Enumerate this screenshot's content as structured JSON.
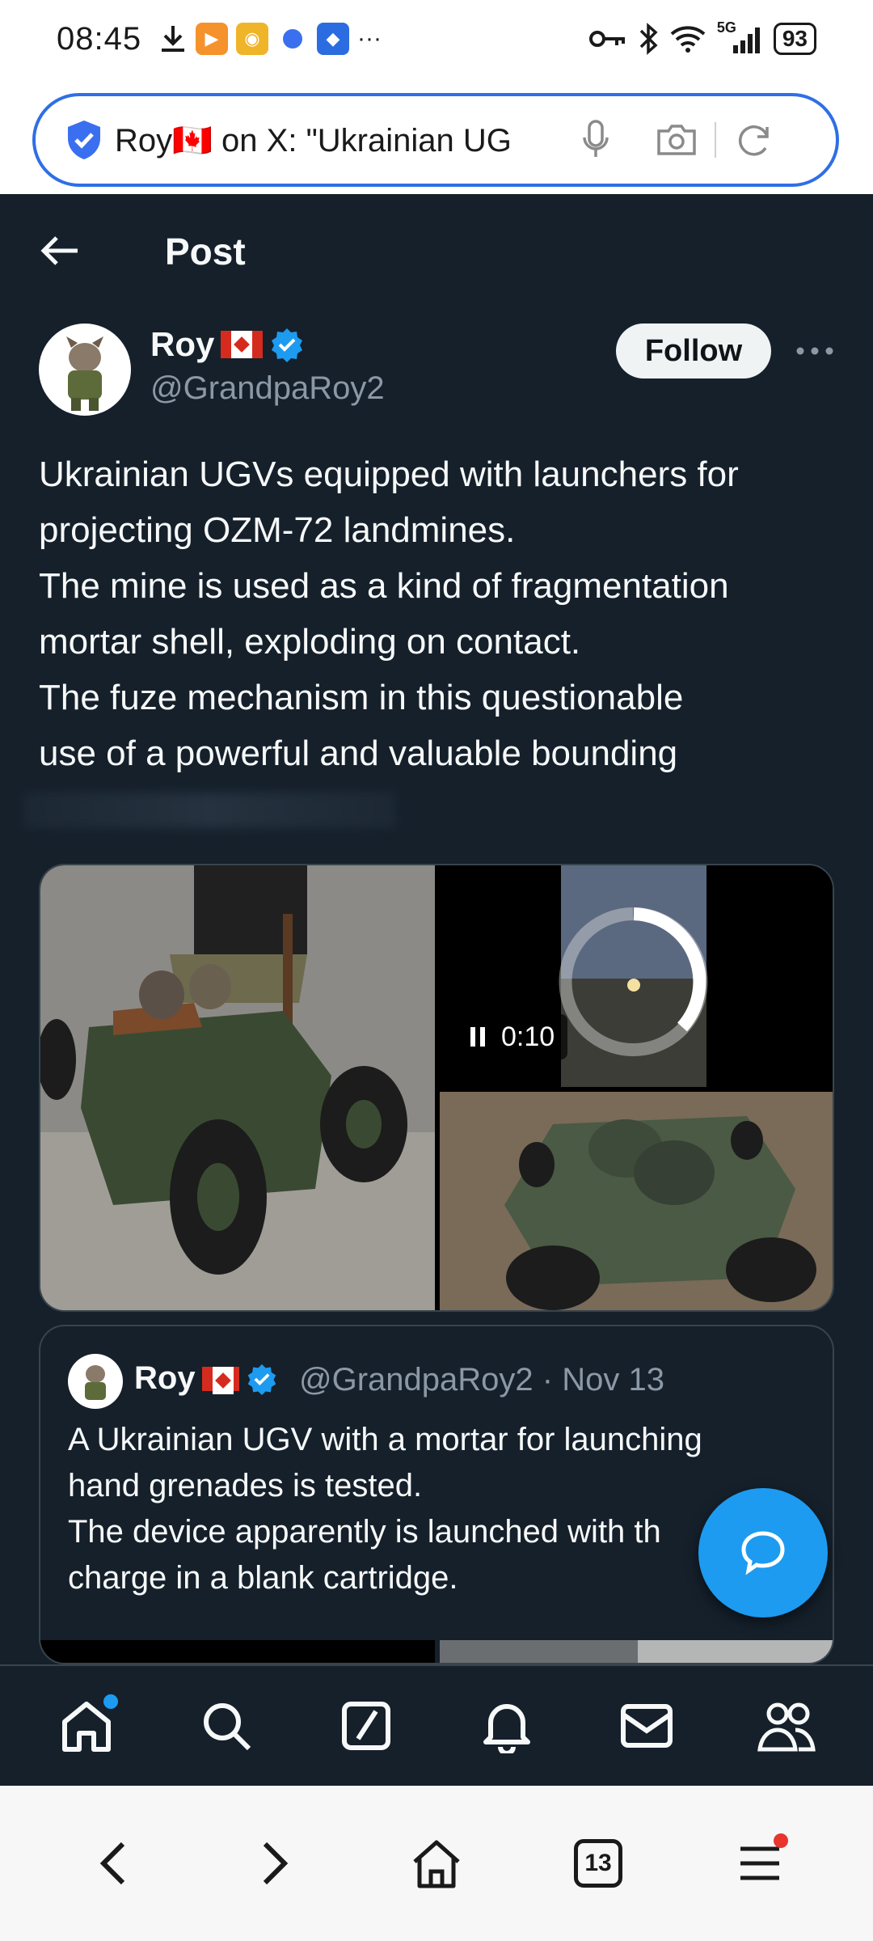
{
  "status_bar": {
    "time": "08:45",
    "battery": "93",
    "network": "5G"
  },
  "browser": {
    "url_text": "Roy🇨🇦 on X: \"Ukrainian UG",
    "tabs_count": "13"
  },
  "header": {
    "title": "Post"
  },
  "post": {
    "author_name": "Roy",
    "author_handle": "@GrandpaRoy2",
    "follow_label": "Follow",
    "text_lines": [
      "Ukrainian UGVs equipped with launchers for",
      "projecting OZM-72 landmines.",
      "The mine is used as a kind of fragmentation",
      "mortar shell, exploding on contact.",
      "The fuze mechanism in this questionable",
      "use of a powerful and valuable bounding"
    ],
    "video_duration": "0:10"
  },
  "quote": {
    "author_name": "Roy",
    "meta": "@GrandpaRoy2 · Nov 13",
    "text_lines": [
      "A Ukrainian UGV with a mortar for launching",
      "hand grenades is tested.",
      "The device apparently is launched with th",
      "charge in a blank cartridge."
    ]
  },
  "colors": {
    "background": "#15202b",
    "accent": "#1d9bf0",
    "muted_text": "#8b98a5",
    "border": "#38444d",
    "url_bar_border": "#2f6fe6"
  },
  "icons": {
    "nav": [
      "home-icon",
      "search-icon",
      "grok-icon",
      "notifications-icon",
      "messages-icon",
      "communities-icon"
    ],
    "browser": [
      "back-icon",
      "forward-icon",
      "home-icon",
      "tabs-icon",
      "menu-icon"
    ]
  }
}
